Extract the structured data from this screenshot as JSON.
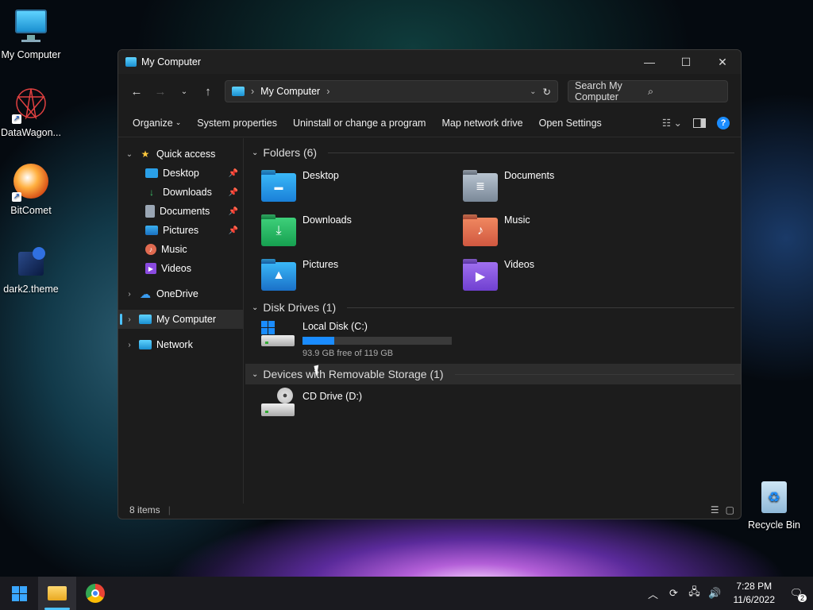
{
  "desktop": {
    "icons": [
      {
        "label": "My Computer"
      },
      {
        "label": "DataWagon..."
      },
      {
        "label": "BitComet"
      },
      {
        "label": "dark2.theme"
      }
    ],
    "recycle_bin": "Recycle Bin"
  },
  "window": {
    "title": "My Computer",
    "address": "My Computer",
    "search_placeholder": "Search My Computer",
    "commands": [
      "Organize",
      "System properties",
      "Uninstall or change a program",
      "Map network drive",
      "Open Settings"
    ],
    "nav": {
      "quick_access": "Quick access",
      "quick_items": [
        "Desktop",
        "Downloads",
        "Documents",
        "Pictures",
        "Music",
        "Videos"
      ],
      "onedrive": "OneDrive",
      "my_computer": "My Computer",
      "network": "Network"
    },
    "groups": {
      "folders": "Folders (6)",
      "disk_drives": "Disk Drives (1)",
      "removable": "Devices with Removable Storage (1)"
    },
    "folders": [
      "Desktop",
      "Documents",
      "Downloads",
      "Music",
      "Pictures",
      "Videos"
    ],
    "disk": {
      "name": "Local Disk (C:)",
      "free": "93.9 GB free of 119 GB",
      "used_fraction": 0.211
    },
    "cd": {
      "name": "CD Drive (D:)"
    },
    "status": "8 items"
  },
  "taskbar": {
    "time": "7:28 PM",
    "date": "11/6/2022",
    "notifications": "2"
  },
  "colors": {
    "accent": "#1a8cff",
    "selection": "#4cc2ff"
  }
}
